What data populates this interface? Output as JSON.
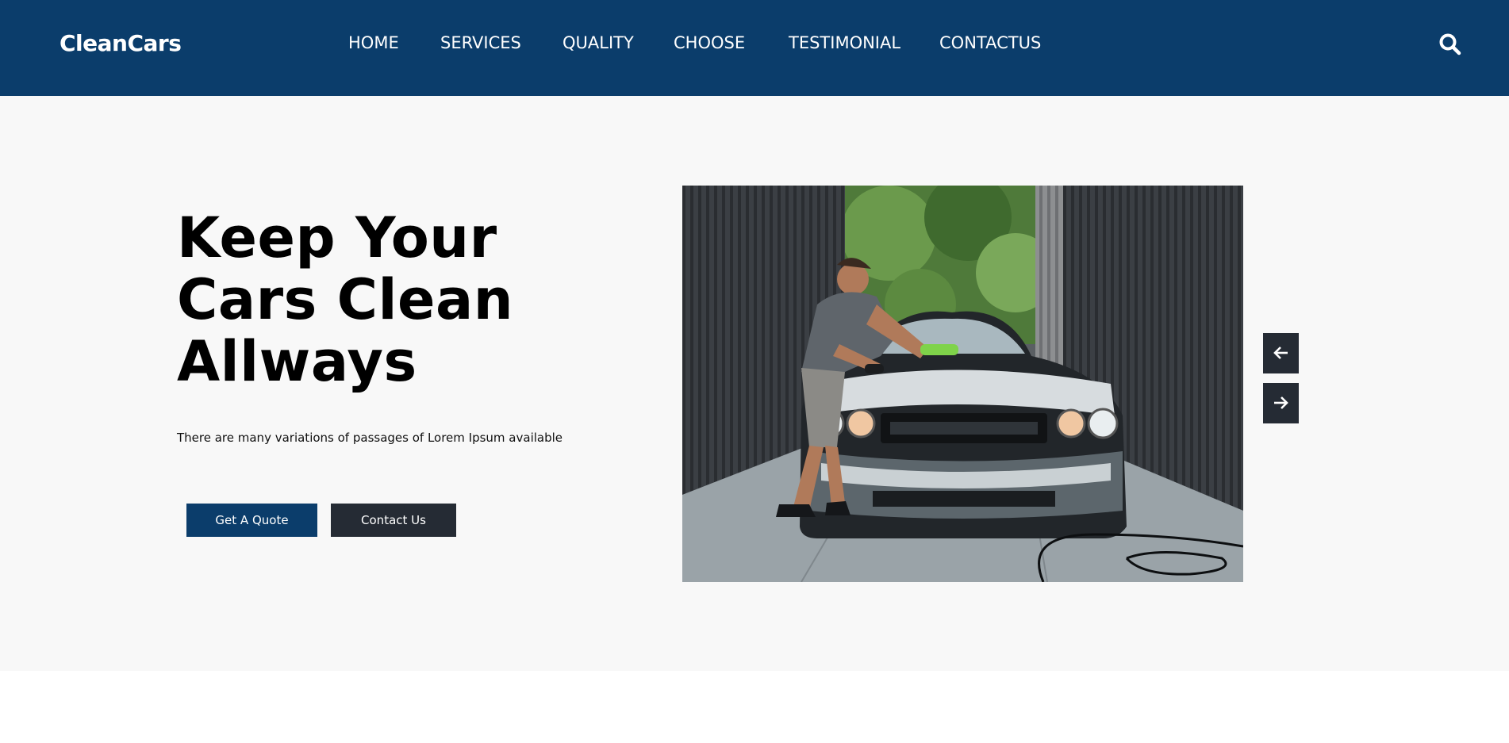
{
  "brand": {
    "name": "CleanCars"
  },
  "nav": {
    "items": [
      {
        "label": "HOME"
      },
      {
        "label": "SERVICES"
      },
      {
        "label": "QUALITY"
      },
      {
        "label": "CHOOSE"
      },
      {
        "label": "TESTIMONIAL"
      },
      {
        "label": "CONTACTUS"
      }
    ],
    "search_icon": "search-icon"
  },
  "hero": {
    "title_lines": [
      "Keep Your",
      "Cars Clean",
      "Allways"
    ],
    "description": "There are many variations of passages of Lorem Ipsum available",
    "primary_button": "Get A Quote",
    "secondary_button": "Contact Us",
    "image_subject": "man washing a soapy black muscle car between metal walls",
    "slider_prev_icon": "arrow-left-icon",
    "slider_next_icon": "arrow-right-icon"
  },
  "colors": {
    "header_bg": "#0b3d6b",
    "hero_bg": "#f8f8f8",
    "primary_button": "#0b3d6b",
    "dark_button": "#252b34",
    "text_dark": "#000000",
    "text_light": "#ffffff"
  }
}
